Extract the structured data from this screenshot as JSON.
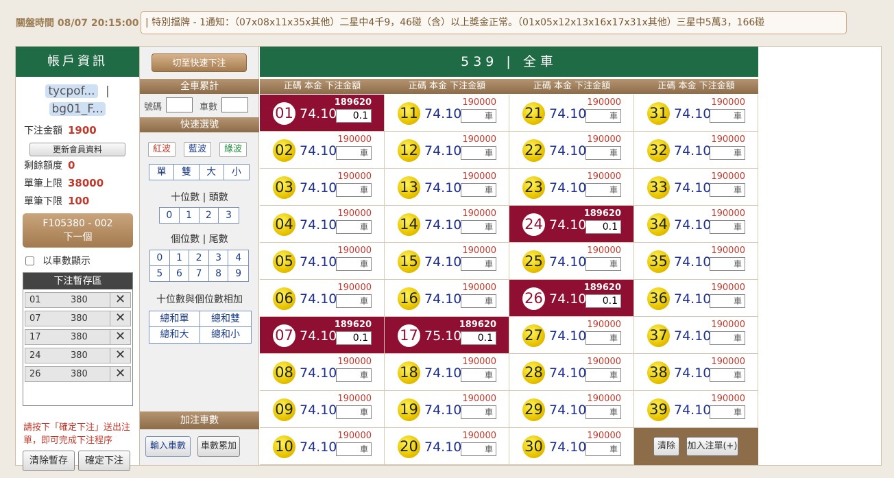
{
  "topbar": {
    "close_time": "關盤時間 08/07 20:15:00",
    "notice": "| 特別擋牌 - 1通知：（07x08x11x35x其他）二星中4千9，46碰（含）以上獎金正常。（01x05x12x13x16x17x31x其他）三星中5萬3，166碰"
  },
  "account": {
    "title": "帳戶資訊",
    "username": "tycpof...",
    "sep": "|",
    "subaccount": "bg01_F...",
    "bet_amount_label": "下注金額",
    "bet_amount": "1900",
    "update_btn": "更新會員資料",
    "remain_label": "剩餘額度",
    "remain": "0",
    "max_label": "單筆上限",
    "max": "38000",
    "min_label": "單筆下限",
    "min": "100",
    "next_code": "F105380 - 002",
    "next_label": "下一個",
    "car_display_label": "以車數顯示",
    "stage_title": "下注暫存區",
    "stage_rows": [
      {
        "num": "01",
        "amount": "380"
      },
      {
        "num": "07",
        "amount": "380"
      },
      {
        "num": "17",
        "amount": "380"
      },
      {
        "num": "24",
        "amount": "380"
      },
      {
        "num": "26",
        "amount": "380"
      }
    ],
    "remove_glyph": "✕",
    "note": "請按下「確定下注」送出注單，即可完成下注程序",
    "clear_btn": "清除暫存",
    "confirm_btn": "確定下注"
  },
  "tools": {
    "quick_btn": "切至快速下注",
    "total_head": "全車累計",
    "num_label": "號碼",
    "car_label": "車數",
    "quick_head": "快速選號",
    "waves": [
      "紅波",
      "藍波",
      "綠波"
    ],
    "wave_colors": [
      "#c0392b",
      "#1d3e8a",
      "#1f8a3a"
    ],
    "parity": [
      "單",
      "雙",
      "大",
      "小"
    ],
    "tens_label": "十位數 | 頭數",
    "tens": [
      "0",
      "1",
      "2",
      "3"
    ],
    "units_label": "個位數 | 尾數",
    "units_row1": [
      "0",
      "1",
      "2",
      "3",
      "4"
    ],
    "units_row2": [
      "5",
      "6",
      "7",
      "8",
      "9"
    ],
    "sum_label": "十位數與個位數相加",
    "sum_btns": [
      "總和單",
      "總和雙",
      "總和大",
      "總和小"
    ],
    "add_head": "加注車數",
    "input_car_btn": "輸入車數",
    "accum_btn": "車數累加"
  },
  "board": {
    "title": "539 | 全車",
    "col_header": "正碼 本金 下注金額",
    "car_placeholder": "車",
    "clear_btn": "清除",
    "add_btn": "加入注單(+)",
    "numbers": [
      {
        "n": "01",
        "odds": "74.10",
        "limit": "189620",
        "sel": true,
        "amt": "0.1"
      },
      {
        "n": "02",
        "odds": "74.10",
        "limit": "190000",
        "sel": false,
        "amt": ""
      },
      {
        "n": "03",
        "odds": "74.10",
        "limit": "190000",
        "sel": false,
        "amt": ""
      },
      {
        "n": "04",
        "odds": "74.10",
        "limit": "190000",
        "sel": false,
        "amt": ""
      },
      {
        "n": "05",
        "odds": "74.10",
        "limit": "190000",
        "sel": false,
        "amt": ""
      },
      {
        "n": "06",
        "odds": "74.10",
        "limit": "190000",
        "sel": false,
        "amt": ""
      },
      {
        "n": "07",
        "odds": "74.10",
        "limit": "189620",
        "sel": true,
        "amt": "0.1"
      },
      {
        "n": "08",
        "odds": "74.10",
        "limit": "190000",
        "sel": false,
        "amt": ""
      },
      {
        "n": "09",
        "odds": "74.10",
        "limit": "190000",
        "sel": false,
        "amt": ""
      },
      {
        "n": "10",
        "odds": "74.10",
        "limit": "190000",
        "sel": false,
        "amt": ""
      },
      {
        "n": "11",
        "odds": "74.10",
        "limit": "190000",
        "sel": false,
        "amt": ""
      },
      {
        "n": "12",
        "odds": "74.10",
        "limit": "190000",
        "sel": false,
        "amt": ""
      },
      {
        "n": "13",
        "odds": "74.10",
        "limit": "190000",
        "sel": false,
        "amt": ""
      },
      {
        "n": "14",
        "odds": "74.10",
        "limit": "190000",
        "sel": false,
        "amt": ""
      },
      {
        "n": "15",
        "odds": "74.10",
        "limit": "190000",
        "sel": false,
        "amt": ""
      },
      {
        "n": "16",
        "odds": "74.10",
        "limit": "190000",
        "sel": false,
        "amt": ""
      },
      {
        "n": "17",
        "odds": "75.10",
        "limit": "189620",
        "sel": true,
        "amt": "0.1"
      },
      {
        "n": "18",
        "odds": "74.10",
        "limit": "190000",
        "sel": false,
        "amt": ""
      },
      {
        "n": "19",
        "odds": "74.10",
        "limit": "190000",
        "sel": false,
        "amt": ""
      },
      {
        "n": "20",
        "odds": "74.10",
        "limit": "190000",
        "sel": false,
        "amt": ""
      },
      {
        "n": "21",
        "odds": "74.10",
        "limit": "190000",
        "sel": false,
        "amt": ""
      },
      {
        "n": "22",
        "odds": "74.10",
        "limit": "190000",
        "sel": false,
        "amt": ""
      },
      {
        "n": "23",
        "odds": "74.10",
        "limit": "190000",
        "sel": false,
        "amt": ""
      },
      {
        "n": "24",
        "odds": "74.10",
        "limit": "189620",
        "sel": true,
        "amt": "0.1"
      },
      {
        "n": "25",
        "odds": "74.10",
        "limit": "190000",
        "sel": false,
        "amt": ""
      },
      {
        "n": "26",
        "odds": "74.10",
        "limit": "189620",
        "sel": true,
        "amt": "0.1"
      },
      {
        "n": "27",
        "odds": "74.10",
        "limit": "190000",
        "sel": false,
        "amt": ""
      },
      {
        "n": "28",
        "odds": "74.10",
        "limit": "190000",
        "sel": false,
        "amt": ""
      },
      {
        "n": "29",
        "odds": "74.10",
        "limit": "190000",
        "sel": false,
        "amt": ""
      },
      {
        "n": "30",
        "odds": "74.10",
        "limit": "190000",
        "sel": false,
        "amt": ""
      },
      {
        "n": "31",
        "odds": "74.10",
        "limit": "190000",
        "sel": false,
        "amt": ""
      },
      {
        "n": "32",
        "odds": "74.10",
        "limit": "190000",
        "sel": false,
        "amt": ""
      },
      {
        "n": "33",
        "odds": "74.10",
        "limit": "190000",
        "sel": false,
        "amt": ""
      },
      {
        "n": "34",
        "odds": "74.10",
        "limit": "190000",
        "sel": false,
        "amt": ""
      },
      {
        "n": "35",
        "odds": "74.10",
        "limit": "190000",
        "sel": false,
        "amt": ""
      },
      {
        "n": "36",
        "odds": "74.10",
        "limit": "190000",
        "sel": false,
        "amt": ""
      },
      {
        "n": "37",
        "odds": "74.10",
        "limit": "190000",
        "sel": false,
        "amt": ""
      },
      {
        "n": "38",
        "odds": "74.10",
        "limit": "190000",
        "sel": false,
        "amt": ""
      },
      {
        "n": "39",
        "odds": "74.10",
        "limit": "190000",
        "sel": false,
        "amt": ""
      }
    ]
  },
  "colors": {
    "green_header": "#1f6b45",
    "selected_cell": "#8f0f32",
    "brown_header": "#8d6c49",
    "ball_yellow": "#e8c400"
  }
}
